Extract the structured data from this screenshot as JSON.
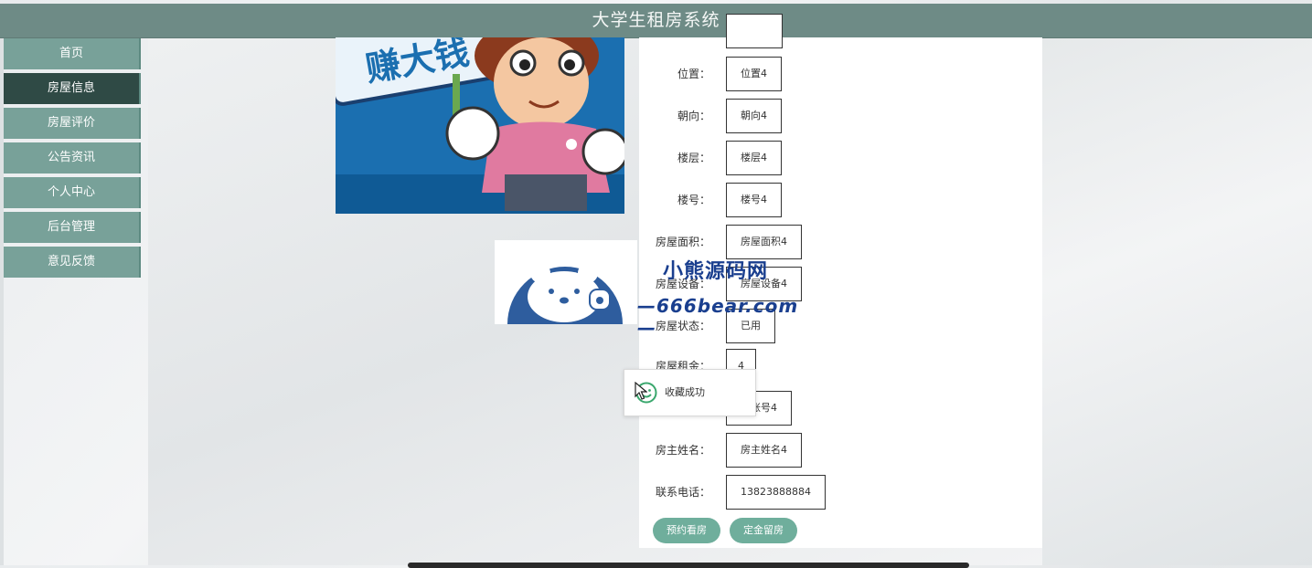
{
  "header": {
    "title": "大学生租房系统"
  },
  "sidebar": {
    "items": [
      {
        "label": "首页",
        "active": false
      },
      {
        "label": "房屋信息",
        "active": true
      },
      {
        "label": "房屋评价",
        "active": false
      },
      {
        "label": "公告资讯",
        "active": false
      },
      {
        "label": "个人中心",
        "active": false
      },
      {
        "label": "后台管理",
        "active": false
      },
      {
        "label": "意见反馈",
        "active": false
      }
    ]
  },
  "photo": {
    "sign_text": "赚大钱"
  },
  "details": {
    "rows": [
      {
        "label": "",
        "value": ""
      },
      {
        "label": "位置：",
        "value": "位置4"
      },
      {
        "label": "朝向：",
        "value": "朝向4"
      },
      {
        "label": "楼层：",
        "value": "楼层4"
      },
      {
        "label": "楼号：",
        "value": "楼号4"
      },
      {
        "label": "房屋面积：",
        "value": "房屋面积4"
      },
      {
        "label": "房屋设备：",
        "value": "房屋设备4"
      },
      {
        "label": "房屋状态：",
        "value": "已用"
      },
      {
        "label": "房屋租金：",
        "value": "4"
      },
      {
        "label": "",
        "value": "主账号4"
      },
      {
        "label": "房主姓名：",
        "value": "房主姓名4"
      },
      {
        "label": "联系电话：",
        "value": "13823888884"
      }
    ]
  },
  "actions": {
    "book_viewing": "预约看房",
    "deposit_reserve": "定金留房"
  },
  "toast": {
    "message": "收藏成功",
    "icon": "smile-icon"
  },
  "watermark": {
    "cn": "小熊源码网",
    "en": "—666bear.com—"
  },
  "colors": {
    "header": "#6e8b86",
    "nav": "#78a199",
    "nav_active": "#2f4a45",
    "button": "#6fae9c"
  }
}
